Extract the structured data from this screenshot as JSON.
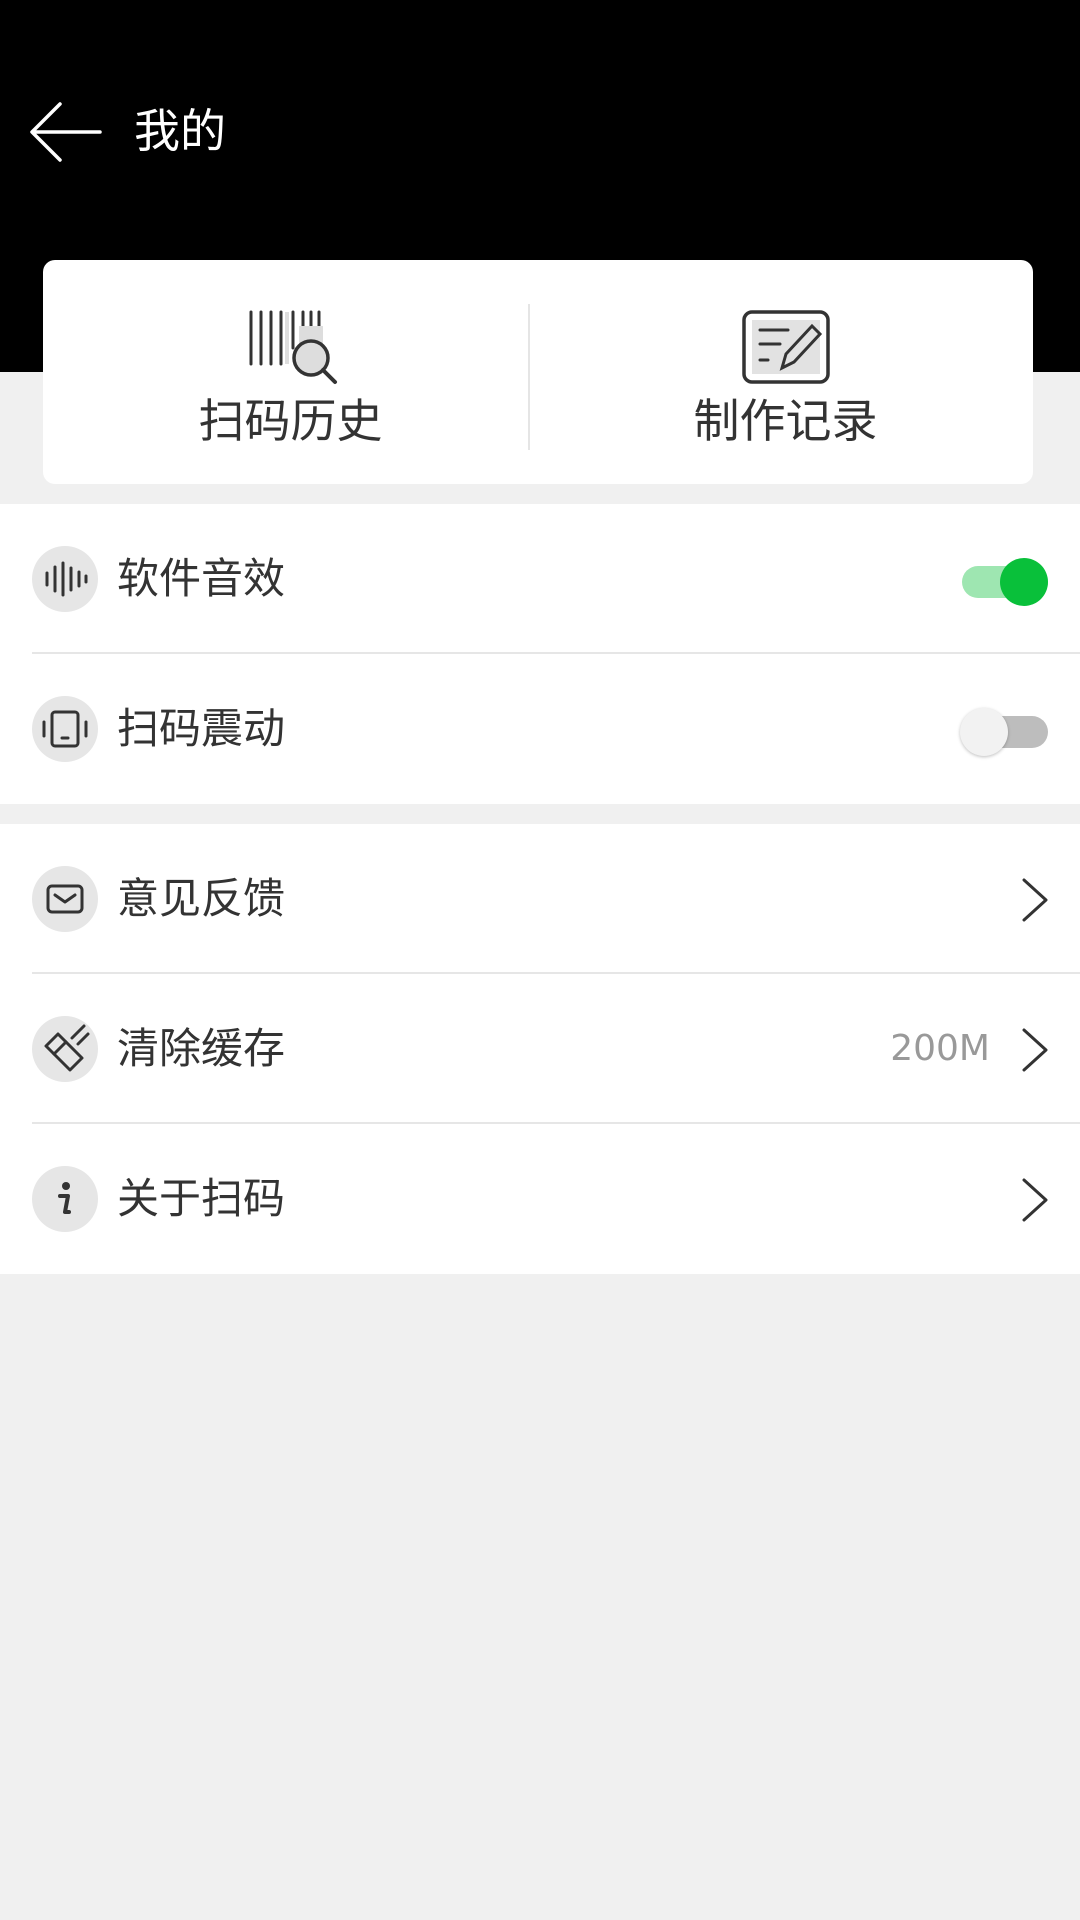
{
  "header": {
    "title": "我的",
    "back_icon": "arrow-left-icon"
  },
  "top_card": {
    "items": [
      {
        "label": "扫码历史",
        "icon": "barcode-search-icon"
      },
      {
        "label": "制作记录",
        "icon": "edit-document-icon"
      }
    ]
  },
  "settings": {
    "items": [
      {
        "label": "软件音效",
        "icon": "sound-wave-icon",
        "toggle_on": true
      },
      {
        "label": "扫码震动",
        "icon": "vibrate-icon",
        "toggle_on": false
      }
    ]
  },
  "menu": {
    "items": [
      {
        "label": "意见反馈",
        "icon": "mail-icon"
      },
      {
        "label": "清除缓存",
        "icon": "eraser-icon",
        "value": "200M"
      },
      {
        "label": "关于扫码",
        "icon": "info-icon"
      }
    ]
  },
  "colors": {
    "header_bg": "#000000",
    "toggle_on": "#09c03a",
    "toggle_on_track": "#9ee6b1",
    "page_bg": "#f0f0f0"
  }
}
